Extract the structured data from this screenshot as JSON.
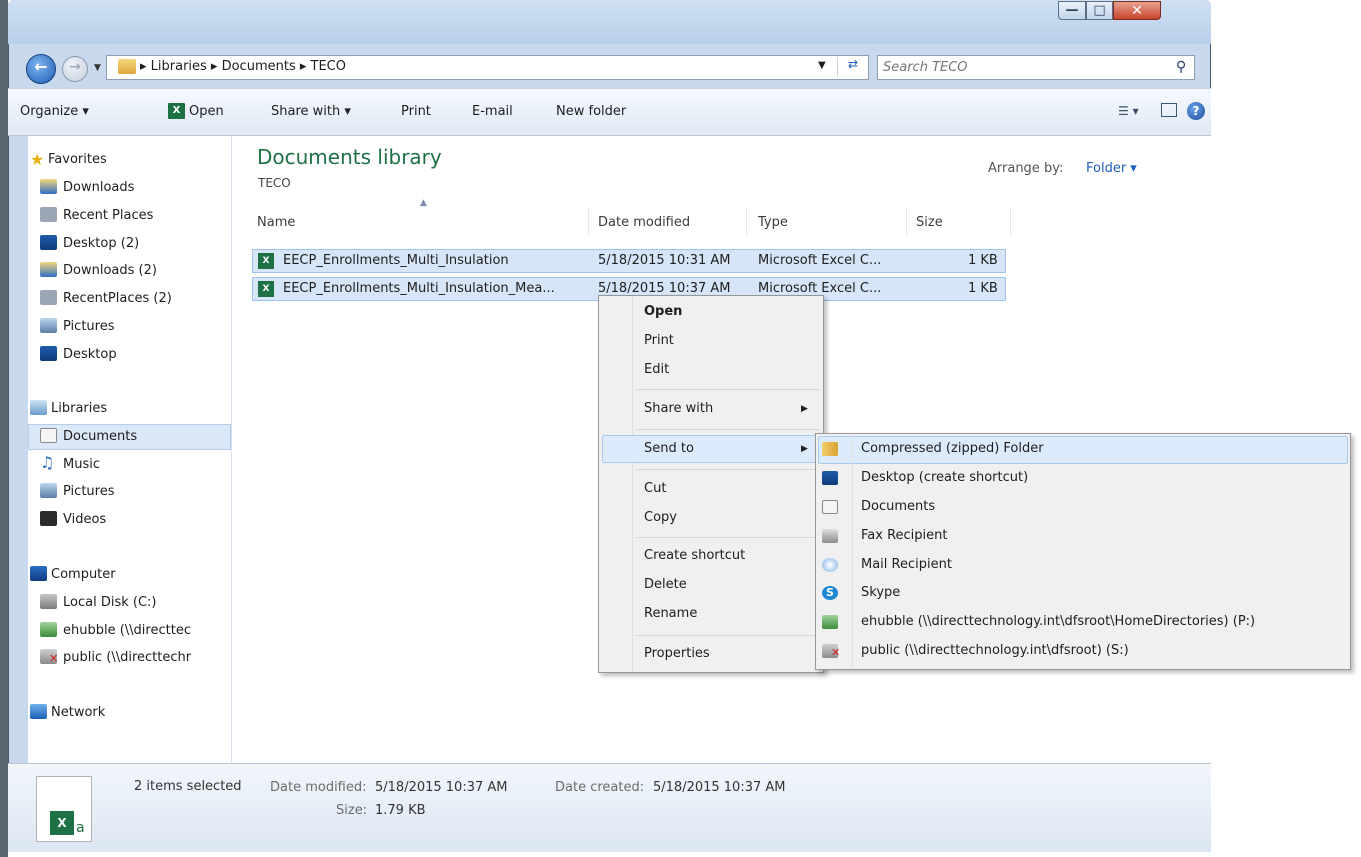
{
  "address": {
    "path": "▸ Libraries ▸ Documents ▸ TECO"
  },
  "search": {
    "placeholder": "Search TECO"
  },
  "toolbar": {
    "organize": "Organize ▾",
    "open": "Open",
    "share_with": "Share with ▾",
    "print": "Print",
    "email": "E-mail",
    "new_folder": "New folder"
  },
  "navpane": {
    "favorites": "Favorites",
    "favorites_items": [
      "Downloads",
      "Recent Places",
      "Desktop (2)",
      "Downloads (2)",
      "RecentPlaces (2)",
      "Pictures",
      "Desktop"
    ],
    "libraries": "Libraries",
    "libraries_items": [
      "Documents",
      "Music",
      "Pictures",
      "Videos"
    ],
    "computer": "Computer",
    "computer_items": [
      "Local Disk (C:)",
      "ehubble (\\\\directtec",
      "public (\\\\directtechr"
    ],
    "network": "Network"
  },
  "library": {
    "title": "Documents library",
    "subtitle": "TECO",
    "arrange_label": "Arrange by:",
    "arrange_value": "Folder ▾"
  },
  "columns": {
    "name": "Name",
    "date": "Date modified",
    "type": "Type",
    "size": "Size"
  },
  "files": [
    {
      "name": "EECP_Enrollments_Multi_Insulation",
      "date": "5/18/2015 10:31 AM",
      "type": "Microsoft Excel C...",
      "size": "1 KB"
    },
    {
      "name": "EECP_Enrollments_Multi_Insulation_Mea...",
      "date": "5/18/2015 10:37 AM",
      "type": "Microsoft Excel C...",
      "size": "1 KB"
    }
  ],
  "context_menu": {
    "open": "Open",
    "print": "Print",
    "edit": "Edit",
    "share_with": "Share with",
    "send_to": "Send to",
    "cut": "Cut",
    "copy": "Copy",
    "create_shortcut": "Create shortcut",
    "delete": "Delete",
    "rename": "Rename",
    "properties": "Properties"
  },
  "send_to_menu": [
    "Compressed (zipped) Folder",
    "Desktop (create shortcut)",
    "Documents",
    "Fax Recipient",
    "Mail Recipient",
    "Skype",
    "ehubble (\\\\directtechnology.int\\dfsroot\\HomeDirectories) (P:)",
    "public (\\\\directtechnology.int\\dfsroot) (S:)"
  ],
  "details": {
    "selected": "2 items selected",
    "date_modified_label": "Date modified:",
    "date_modified": "5/18/2015 10:37 AM",
    "size_label": "Size:",
    "size": "1.79 KB",
    "date_created_label": "Date created:",
    "date_created": "5/18/2015 10:37 AM"
  },
  "colors": {
    "library_green": "#1e7145",
    "selection": "#d6e6f8",
    "link_blue": "#1d5eb8"
  }
}
